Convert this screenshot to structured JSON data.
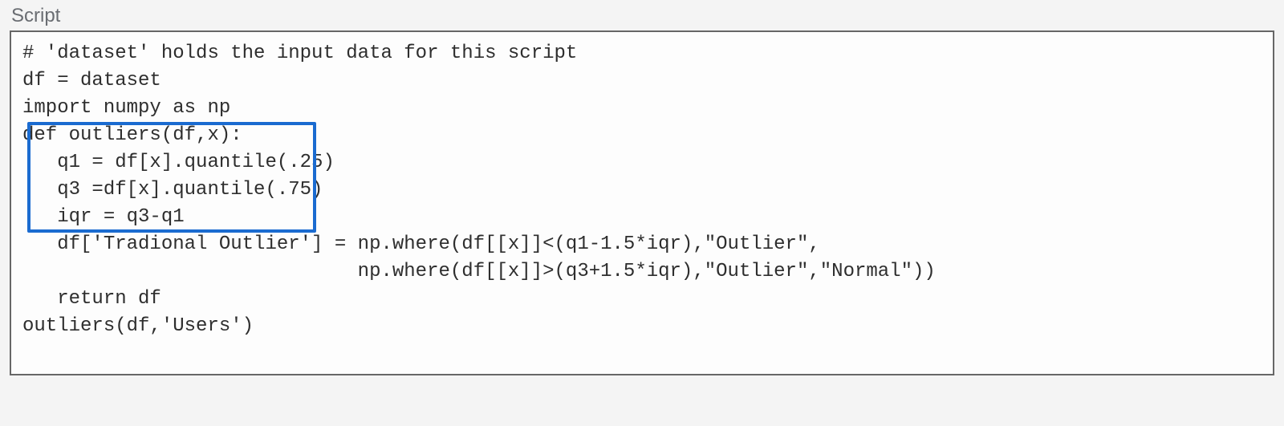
{
  "panel_label": "Script",
  "code": {
    "l0": "# 'dataset' holds the input data for this script",
    "l1": "df = dataset",
    "l2": "import numpy as np",
    "l3": "def outliers(df,x):",
    "l4": "   q1 = df[x].quantile(.25)",
    "l5": "   q3 =df[x].quantile(.75)",
    "l6": "   iqr = q3-q1",
    "l7": "   df['Tradional Outlier'] = np.where(df[[x]]<(q1-1.5*iqr),\"Outlier\",",
    "l8": "                             np.where(df[[x]]>(q3+1.5*iqr),\"Outlier\",\"Normal\"))",
    "l9": "   return df",
    "l10": "",
    "l11": "outliers(df,'Users')"
  }
}
